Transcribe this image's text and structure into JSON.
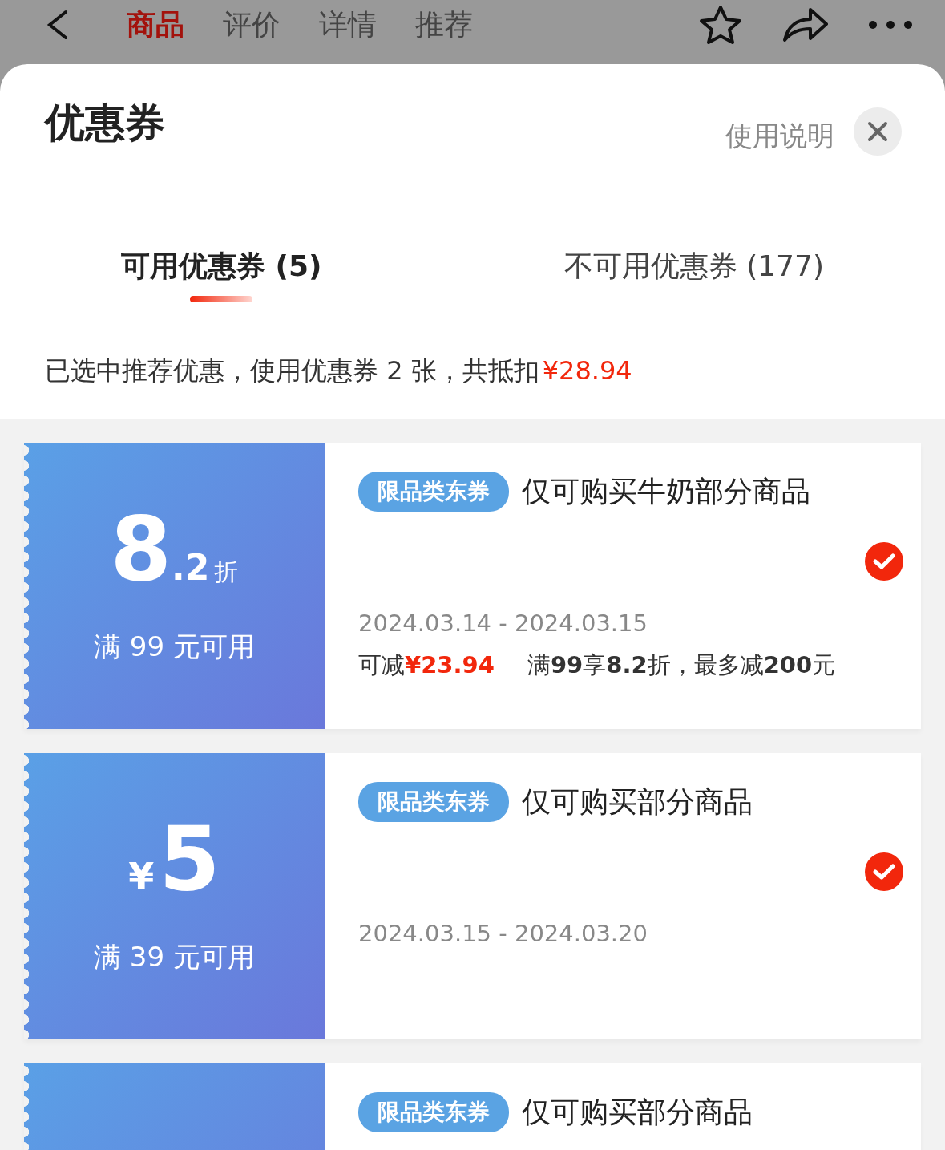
{
  "nav_tabs": [
    {
      "label": "商品",
      "selected": true
    },
    {
      "label": "评价",
      "selected": false
    },
    {
      "label": "详情",
      "selected": false
    },
    {
      "label": "推荐",
      "selected": false
    }
  ],
  "sheet": {
    "title": "优惠券",
    "help_link": "使用说明"
  },
  "tabs": [
    {
      "label": "可用优惠券 (5)",
      "selected": true
    },
    {
      "label": "不可用优惠券 (177)",
      "selected": false
    }
  ],
  "summary": {
    "text": "已选中推荐优惠，使用优惠券 2 张，共抵扣",
    "amount": "¥28.94"
  },
  "coupons": [
    {
      "kind": "discount",
      "amount": "8",
      "decimal": ".2",
      "unit": "折",
      "condition": "满 99 元可用",
      "tag": "限品类东券",
      "title": "仅可购买牛奶部分商品",
      "dates": "2024.03.14 - 2024.03.15",
      "saving_label": "可减",
      "saving": "¥23.94",
      "rule": "满**99**享**8.2**折，最多减**200**元",
      "selected": true
    },
    {
      "kind": "cash",
      "currency": "¥",
      "amount": "5",
      "condition": "满 39 元可用",
      "tag": "限品类东券",
      "title": "仅可购买部分商品",
      "dates": "2024.03.15 - 2024.03.20",
      "selected": true
    },
    {
      "kind": "cut",
      "tag": "限品类东券",
      "title": "仅可购买部分商品"
    }
  ]
}
